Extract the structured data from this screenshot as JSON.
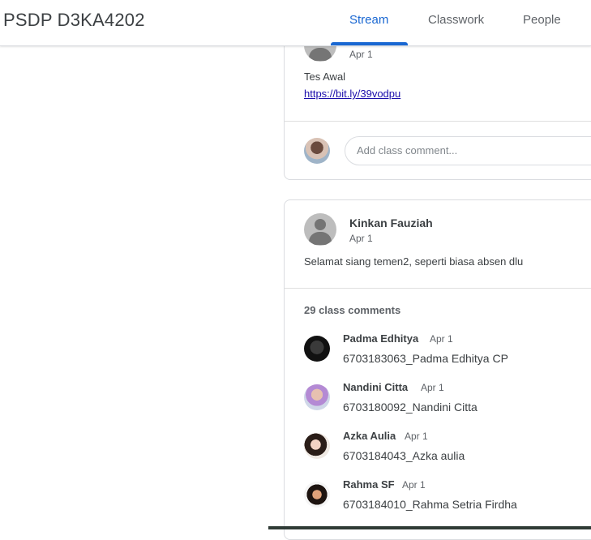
{
  "header": {
    "class_title": "PSDP D3KA4202",
    "tabs": [
      {
        "label": "Stream"
      },
      {
        "label": "Classwork"
      },
      {
        "label": "People"
      }
    ]
  },
  "post1": {
    "date": "Apr 1",
    "text": "Tes Awal",
    "link": "https://bit.ly/39vodpu",
    "comment_placeholder": "Add class comment..."
  },
  "post2": {
    "author": "Kinkan Fauziah",
    "date": "Apr 1",
    "text": "Selamat siang temen2, seperti biasa absen dlu",
    "comment_count": "29 class comments",
    "comments": [
      {
        "name": "Padma Edhitya",
        "date": "Apr 1",
        "text": "6703183063_Padma Edhitya CP"
      },
      {
        "name": "Nandini Citta",
        "date": "Apr 1",
        "text": "6703180092_Nandini Citta"
      },
      {
        "name": "Azka Aulia",
        "date": "Apr 1",
        "text": "6703184043_Azka aulia"
      },
      {
        "name": "Rahma SF",
        "date": "Apr 1",
        "text": "6703184010_Rahma Setria Firdha"
      }
    ]
  },
  "colors": {
    "accent": "#1967d2",
    "border": "#dadce0",
    "text": "#3c4043",
    "muted": "#5f6368"
  }
}
